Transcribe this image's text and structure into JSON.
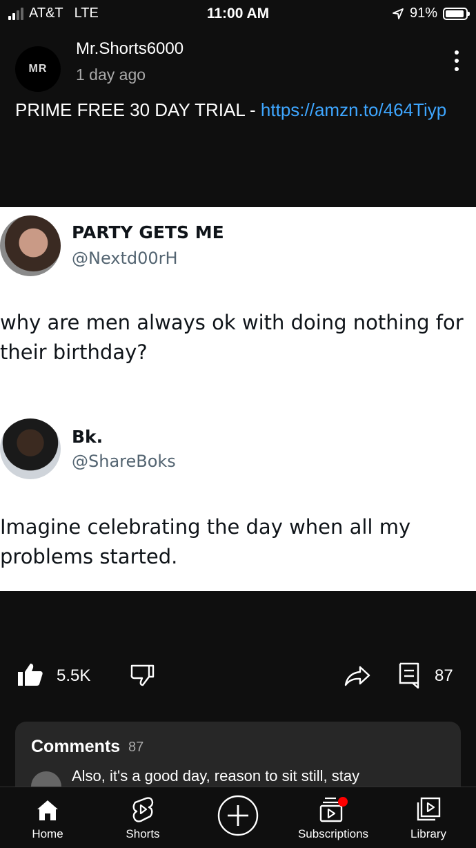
{
  "status_bar": {
    "carrier": "AT&T",
    "network": "LTE",
    "time": "11:00 AM",
    "battery": "91%"
  },
  "post": {
    "avatar_text": "MR",
    "channel": "Mr.Shorts6000",
    "age": "1 day ago",
    "text_prefix": "PRIME FREE 30 DAY TRIAL - ",
    "link": "https://amzn.to/464Tiyp"
  },
  "image": {
    "tweet1": {
      "name": "PARTY GETS ME",
      "handle": "@Nextd00rH",
      "body": "why are men always ok with doing nothing for their birthday?"
    },
    "tweet2": {
      "name": "Bk.",
      "handle": "@ShareBoks",
      "body": "Imagine celebrating the day when all my problems started."
    }
  },
  "actions": {
    "likes": "5.5K",
    "comments_count": "87"
  },
  "comments": {
    "title": "Comments",
    "count": "87",
    "preview": "Also, it's a good day, reason to sit still, stay"
  },
  "nav": [
    {
      "label": "Home",
      "icon": "home-icon"
    },
    {
      "label": "Shorts",
      "icon": "shorts-icon"
    },
    {
      "label": "",
      "icon": "create-icon"
    },
    {
      "label": "Subscriptions",
      "icon": "subscriptions-icon"
    },
    {
      "label": "Library",
      "icon": "library-icon"
    }
  ],
  "colors": {
    "background": "#0f0f0f",
    "link": "#3ea6ff",
    "card": "#272727",
    "notification_dot": "#ff0000"
  }
}
